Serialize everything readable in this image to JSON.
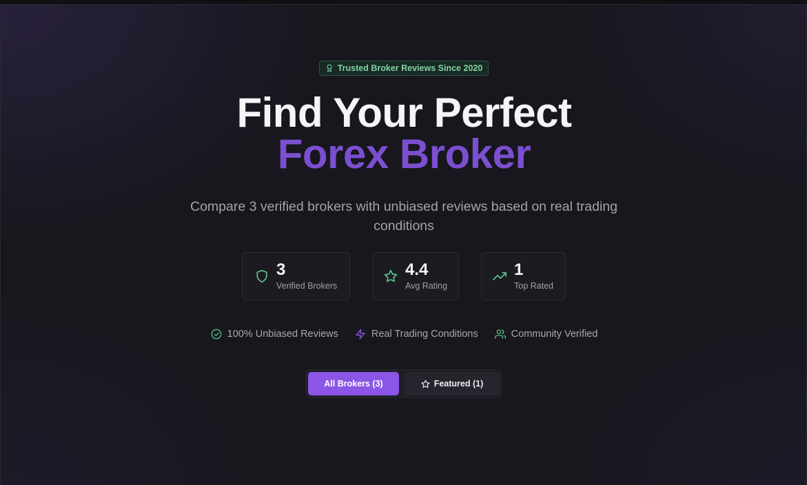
{
  "badge": {
    "icon": "award-icon",
    "text": "Trusted Broker Reviews Since 2020"
  },
  "hero": {
    "title_line1": "Find Your Perfect",
    "title_line2": "Forex Broker",
    "subtitle": "Compare 3 verified brokers with unbiased reviews based on real trading conditions"
  },
  "stats": [
    {
      "icon": "shield-icon",
      "value": "3",
      "label": "Verified Brokers"
    },
    {
      "icon": "star-icon",
      "value": "4.4",
      "label": "Avg Rating"
    },
    {
      "icon": "trending-up-icon",
      "value": "1",
      "label": "Top Rated"
    }
  ],
  "features": [
    {
      "icon": "check-circle-icon",
      "label": "100% Unbiased Reviews"
    },
    {
      "icon": "zap-icon",
      "label": "Real Trading Conditions"
    },
    {
      "icon": "users-icon",
      "label": "Community Verified"
    }
  ],
  "tabs": [
    {
      "label": "All Brokers (3)",
      "active": true
    },
    {
      "label": "Featured (1)",
      "icon": "star-icon",
      "active": false
    }
  ],
  "colors": {
    "accent": "#8b55e6",
    "title_accent": "#7b4fd0",
    "green": "#5fc48a",
    "background": "#17171d"
  }
}
